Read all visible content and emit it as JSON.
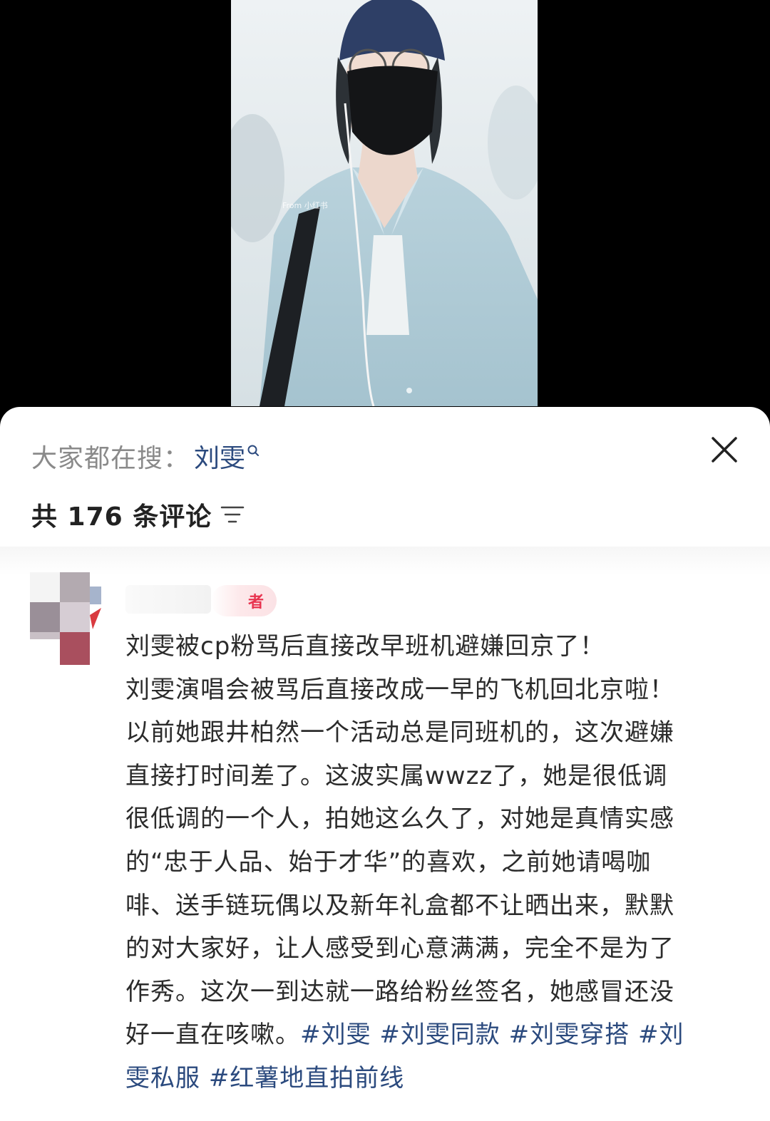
{
  "video": {
    "watermark": "From 小红书"
  },
  "search": {
    "prefix": "大家都在搜：",
    "term": "刘雯"
  },
  "comments": {
    "count_label": "共 176 条评论"
  },
  "comment": {
    "author_badge": "者",
    "lines": [
      "刘雯被cp粉骂后直接改早班机避嫌回京了！",
      "刘雯演唱会被骂后直接改成一早的飞机回北京啦！",
      "以前她跟井柏然一个活动总是同班机的，这次避嫌",
      "直接打时间差了。这波实属wwzz了，她是很低调",
      "很低调的一个人，拍她这么久了，对她是真情实感",
      "的“忠于人品、始于才华”的喜欢，之前她请喝咖",
      "啡、送手链玩偶以及新年礼盒都不让晒出来，默默",
      "的对大家好，让人感受到心意满满，完全不是为了",
      "作秀。这次一到达就一路给粉丝签名，她感冒还没"
    ],
    "line10_text": "好一直在咳嗽。",
    "tags": [
      "#刘雯",
      "#刘雯同款",
      "#刘雯穿搭",
      "#刘",
      "雯私服",
      "#红薯地直拍前线"
    ]
  },
  "colors": {
    "link": "#2b4a7e",
    "badge_text": "#e8344f",
    "text": "#2b2b2b",
    "muted": "#8a8a8a"
  },
  "icons": [
    "search-icon",
    "close-icon",
    "sort-icon"
  ]
}
